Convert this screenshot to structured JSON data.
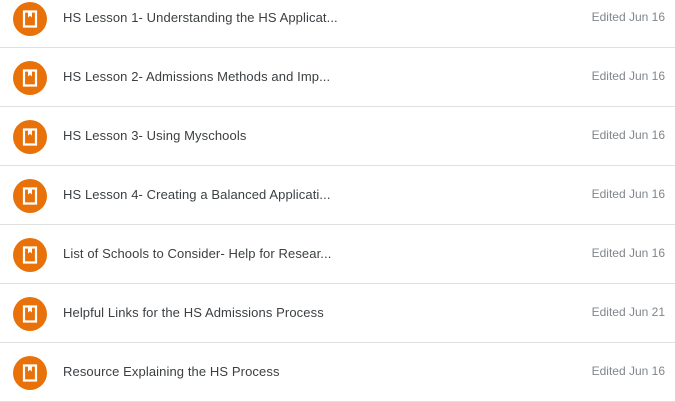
{
  "materials": {
    "items": [
      {
        "icon": "book-icon",
        "title": "HS Lesson 1- Understanding the HS Applicat...",
        "edited": "Edited Jun 16"
      },
      {
        "icon": "book-icon",
        "title": "HS Lesson 2- Admissions Methods and Imp...",
        "edited": "Edited Jun 16"
      },
      {
        "icon": "book-icon",
        "title": "HS Lesson 3- Using Myschools",
        "edited": "Edited Jun 16"
      },
      {
        "icon": "book-icon",
        "title": "HS Lesson 4- Creating a Balanced Applicati...",
        "edited": "Edited Jun 16"
      },
      {
        "icon": "book-icon",
        "title": "List of Schools to Consider- Help for Resear...",
        "edited": "Edited Jun 16"
      },
      {
        "icon": "book-icon",
        "title": "Helpful Links for the HS Admissions Process",
        "edited": "Edited Jun 21"
      },
      {
        "icon": "book-icon",
        "title": "Resource Explaining the HS Process",
        "edited": "Edited Jun 16"
      }
    ]
  },
  "colors": {
    "icon_background": "#e8710a",
    "title_text": "#3c4043",
    "meta_text": "#80868b",
    "divider": "#e0e0e0"
  }
}
